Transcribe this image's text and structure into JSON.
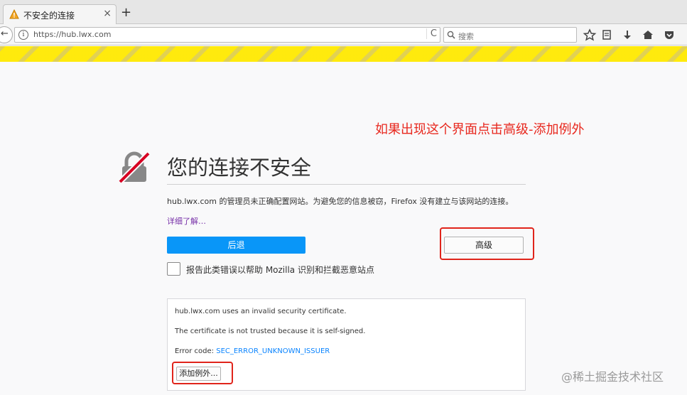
{
  "tab": {
    "title": "不安全的连接",
    "close_glyph": "×",
    "new_tab_glyph": "+"
  },
  "nav": {
    "back_glyph": "←",
    "url": "https://hub.lwx.com",
    "info_glyph": "i",
    "reload_glyph": "C",
    "search_placeholder": "搜索",
    "icons": [
      "star-icon",
      "reading-list-icon",
      "download-icon",
      "home-icon",
      "pocket-icon"
    ]
  },
  "annotation": "如果出现这个界面点击高级-添加例外",
  "error": {
    "title": "您的连接不安全",
    "description": "hub.lwx.com 的管理员未正确配置网站。为避免您的信息被窃，Firefox 没有建立与该网站的连接。",
    "learn_more": "详细了解…",
    "back_button": "后退",
    "advanced_button": "高级",
    "report_label": "报告此类错误以帮助 Mozilla 识别和拦截恶意站点"
  },
  "advanced_panel": {
    "line1": "hub.lwx.com uses an invalid security certificate.",
    "line2": "The certificate is not trusted because it is self-signed.",
    "error_code_label": "Error code: ",
    "error_code": "SEC_ERROR_UNKNOWN_ISSUER",
    "add_exception_button": "添加例外..."
  },
  "watermark": "@稀土掘金技术社区",
  "colors": {
    "accent": "#0996f8",
    "highlight": "#e0241b",
    "warning_stripe": "#ffe900",
    "link": "#7730a8"
  }
}
